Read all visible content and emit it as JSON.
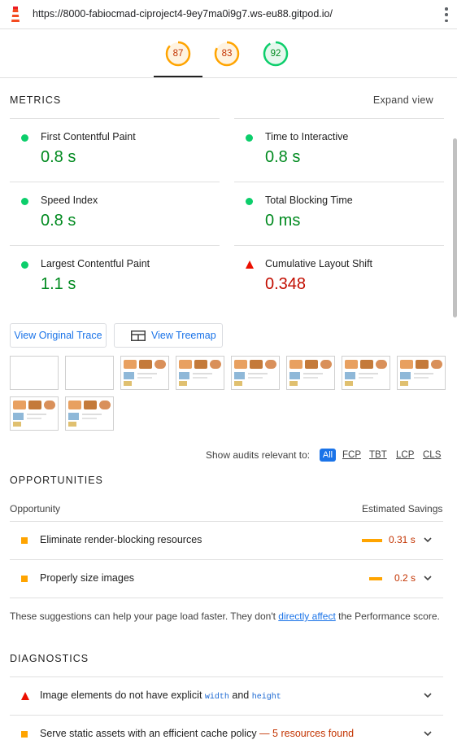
{
  "browser": {
    "url": "https://8000-fabiocmad-ciproject4-9ey7ma0i9g7.ws-eu88.gitpod.io/"
  },
  "scores": [
    {
      "value": "87",
      "fraction": 0.87,
      "color": "#ffa400",
      "text_color": "#c33300",
      "bg": "#fff3e0"
    },
    {
      "value": "83",
      "fraction": 0.83,
      "color": "#ffa400",
      "text_color": "#c33300",
      "bg": "#fff3e0"
    },
    {
      "value": "92",
      "fraction": 0.92,
      "color": "#0cce6b",
      "text_color": "#008a1f",
      "bg": "#e6f8ee"
    }
  ],
  "metrics": {
    "title": "METRICS",
    "expand_label": "Expand view",
    "items": [
      {
        "name": "First Contentful Paint",
        "value": "0.8 s",
        "status": "pass"
      },
      {
        "name": "Time to Interactive",
        "value": "0.8 s",
        "status": "pass"
      },
      {
        "name": "Speed Index",
        "value": "0.8 s",
        "status": "pass"
      },
      {
        "name": "Total Blocking Time",
        "value": "0 ms",
        "status": "pass"
      },
      {
        "name": "Largest Contentful Paint",
        "value": "1.1 s",
        "status": "pass"
      },
      {
        "name": "Cumulative Layout Shift",
        "value": "0.348",
        "status": "fail"
      }
    ]
  },
  "buttons": {
    "trace": "View Original Trace",
    "treemap": "View Treemap"
  },
  "filter": {
    "label": "Show audits relevant to:",
    "chips": [
      "All",
      "FCP",
      "TBT",
      "LCP",
      "CLS"
    ]
  },
  "opportunities": {
    "title": "OPPORTUNITIES",
    "col_opportunity": "Opportunity",
    "col_savings": "Estimated Savings",
    "items": [
      {
        "title": "Eliminate render-blocking resources",
        "savings": "0.31 s",
        "fraction": 0.31
      },
      {
        "title": "Properly size images",
        "savings": "0.2 s",
        "fraction": 0.2
      }
    ],
    "note_prefix": "These suggestions can help your page load faster. They don't ",
    "note_link": "directly affect",
    "note_suffix": " the Performance score."
  },
  "diagnostics": {
    "title": "DIAGNOSTICS",
    "item1_prefix": "Image elements do not have explicit ",
    "item1_code1": "width",
    "item1_and": " and ",
    "item1_code2": "height",
    "item2_title": "Serve static assets with an efficient cache policy",
    "item2_sep": " — ",
    "item2_found": "5 resources found"
  }
}
